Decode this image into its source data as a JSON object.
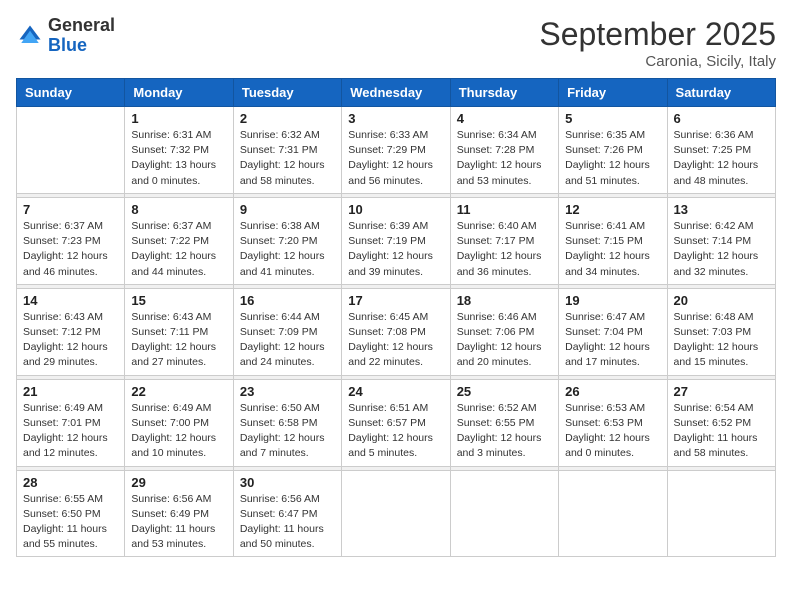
{
  "header": {
    "logo_general": "General",
    "logo_blue": "Blue",
    "month_title": "September 2025",
    "location": "Caronia, Sicily, Italy"
  },
  "weekdays": [
    "Sunday",
    "Monday",
    "Tuesday",
    "Wednesday",
    "Thursday",
    "Friday",
    "Saturday"
  ],
  "weeks": [
    [
      {
        "day": "",
        "sunrise": "",
        "sunset": "",
        "daylight": ""
      },
      {
        "day": "1",
        "sunrise": "Sunrise: 6:31 AM",
        "sunset": "Sunset: 7:32 PM",
        "daylight": "Daylight: 13 hours and 0 minutes."
      },
      {
        "day": "2",
        "sunrise": "Sunrise: 6:32 AM",
        "sunset": "Sunset: 7:31 PM",
        "daylight": "Daylight: 12 hours and 58 minutes."
      },
      {
        "day": "3",
        "sunrise": "Sunrise: 6:33 AM",
        "sunset": "Sunset: 7:29 PM",
        "daylight": "Daylight: 12 hours and 56 minutes."
      },
      {
        "day": "4",
        "sunrise": "Sunrise: 6:34 AM",
        "sunset": "Sunset: 7:28 PM",
        "daylight": "Daylight: 12 hours and 53 minutes."
      },
      {
        "day": "5",
        "sunrise": "Sunrise: 6:35 AM",
        "sunset": "Sunset: 7:26 PM",
        "daylight": "Daylight: 12 hours and 51 minutes."
      },
      {
        "day": "6",
        "sunrise": "Sunrise: 6:36 AM",
        "sunset": "Sunset: 7:25 PM",
        "daylight": "Daylight: 12 hours and 48 minutes."
      }
    ],
    [
      {
        "day": "7",
        "sunrise": "Sunrise: 6:37 AM",
        "sunset": "Sunset: 7:23 PM",
        "daylight": "Daylight: 12 hours and 46 minutes."
      },
      {
        "day": "8",
        "sunrise": "Sunrise: 6:37 AM",
        "sunset": "Sunset: 7:22 PM",
        "daylight": "Daylight: 12 hours and 44 minutes."
      },
      {
        "day": "9",
        "sunrise": "Sunrise: 6:38 AM",
        "sunset": "Sunset: 7:20 PM",
        "daylight": "Daylight: 12 hours and 41 minutes."
      },
      {
        "day": "10",
        "sunrise": "Sunrise: 6:39 AM",
        "sunset": "Sunset: 7:19 PM",
        "daylight": "Daylight: 12 hours and 39 minutes."
      },
      {
        "day": "11",
        "sunrise": "Sunrise: 6:40 AM",
        "sunset": "Sunset: 7:17 PM",
        "daylight": "Daylight: 12 hours and 36 minutes."
      },
      {
        "day": "12",
        "sunrise": "Sunrise: 6:41 AM",
        "sunset": "Sunset: 7:15 PM",
        "daylight": "Daylight: 12 hours and 34 minutes."
      },
      {
        "day": "13",
        "sunrise": "Sunrise: 6:42 AM",
        "sunset": "Sunset: 7:14 PM",
        "daylight": "Daylight: 12 hours and 32 minutes."
      }
    ],
    [
      {
        "day": "14",
        "sunrise": "Sunrise: 6:43 AM",
        "sunset": "Sunset: 7:12 PM",
        "daylight": "Daylight: 12 hours and 29 minutes."
      },
      {
        "day": "15",
        "sunrise": "Sunrise: 6:43 AM",
        "sunset": "Sunset: 7:11 PM",
        "daylight": "Daylight: 12 hours and 27 minutes."
      },
      {
        "day": "16",
        "sunrise": "Sunrise: 6:44 AM",
        "sunset": "Sunset: 7:09 PM",
        "daylight": "Daylight: 12 hours and 24 minutes."
      },
      {
        "day": "17",
        "sunrise": "Sunrise: 6:45 AM",
        "sunset": "Sunset: 7:08 PM",
        "daylight": "Daylight: 12 hours and 22 minutes."
      },
      {
        "day": "18",
        "sunrise": "Sunrise: 6:46 AM",
        "sunset": "Sunset: 7:06 PM",
        "daylight": "Daylight: 12 hours and 20 minutes."
      },
      {
        "day": "19",
        "sunrise": "Sunrise: 6:47 AM",
        "sunset": "Sunset: 7:04 PM",
        "daylight": "Daylight: 12 hours and 17 minutes."
      },
      {
        "day": "20",
        "sunrise": "Sunrise: 6:48 AM",
        "sunset": "Sunset: 7:03 PM",
        "daylight": "Daylight: 12 hours and 15 minutes."
      }
    ],
    [
      {
        "day": "21",
        "sunrise": "Sunrise: 6:49 AM",
        "sunset": "Sunset: 7:01 PM",
        "daylight": "Daylight: 12 hours and 12 minutes."
      },
      {
        "day": "22",
        "sunrise": "Sunrise: 6:49 AM",
        "sunset": "Sunset: 7:00 PM",
        "daylight": "Daylight: 12 hours and 10 minutes."
      },
      {
        "day": "23",
        "sunrise": "Sunrise: 6:50 AM",
        "sunset": "Sunset: 6:58 PM",
        "daylight": "Daylight: 12 hours and 7 minutes."
      },
      {
        "day": "24",
        "sunrise": "Sunrise: 6:51 AM",
        "sunset": "Sunset: 6:57 PM",
        "daylight": "Daylight: 12 hours and 5 minutes."
      },
      {
        "day": "25",
        "sunrise": "Sunrise: 6:52 AM",
        "sunset": "Sunset: 6:55 PM",
        "daylight": "Daylight: 12 hours and 3 minutes."
      },
      {
        "day": "26",
        "sunrise": "Sunrise: 6:53 AM",
        "sunset": "Sunset: 6:53 PM",
        "daylight": "Daylight: 12 hours and 0 minutes."
      },
      {
        "day": "27",
        "sunrise": "Sunrise: 6:54 AM",
        "sunset": "Sunset: 6:52 PM",
        "daylight": "Daylight: 11 hours and 58 minutes."
      }
    ],
    [
      {
        "day": "28",
        "sunrise": "Sunrise: 6:55 AM",
        "sunset": "Sunset: 6:50 PM",
        "daylight": "Daylight: 11 hours and 55 minutes."
      },
      {
        "day": "29",
        "sunrise": "Sunrise: 6:56 AM",
        "sunset": "Sunset: 6:49 PM",
        "daylight": "Daylight: 11 hours and 53 minutes."
      },
      {
        "day": "30",
        "sunrise": "Sunrise: 6:56 AM",
        "sunset": "Sunset: 6:47 PM",
        "daylight": "Daylight: 11 hours and 50 minutes."
      },
      {
        "day": "",
        "sunrise": "",
        "sunset": "",
        "daylight": ""
      },
      {
        "day": "",
        "sunrise": "",
        "sunset": "",
        "daylight": ""
      },
      {
        "day": "",
        "sunrise": "",
        "sunset": "",
        "daylight": ""
      },
      {
        "day": "",
        "sunrise": "",
        "sunset": "",
        "daylight": ""
      }
    ]
  ]
}
